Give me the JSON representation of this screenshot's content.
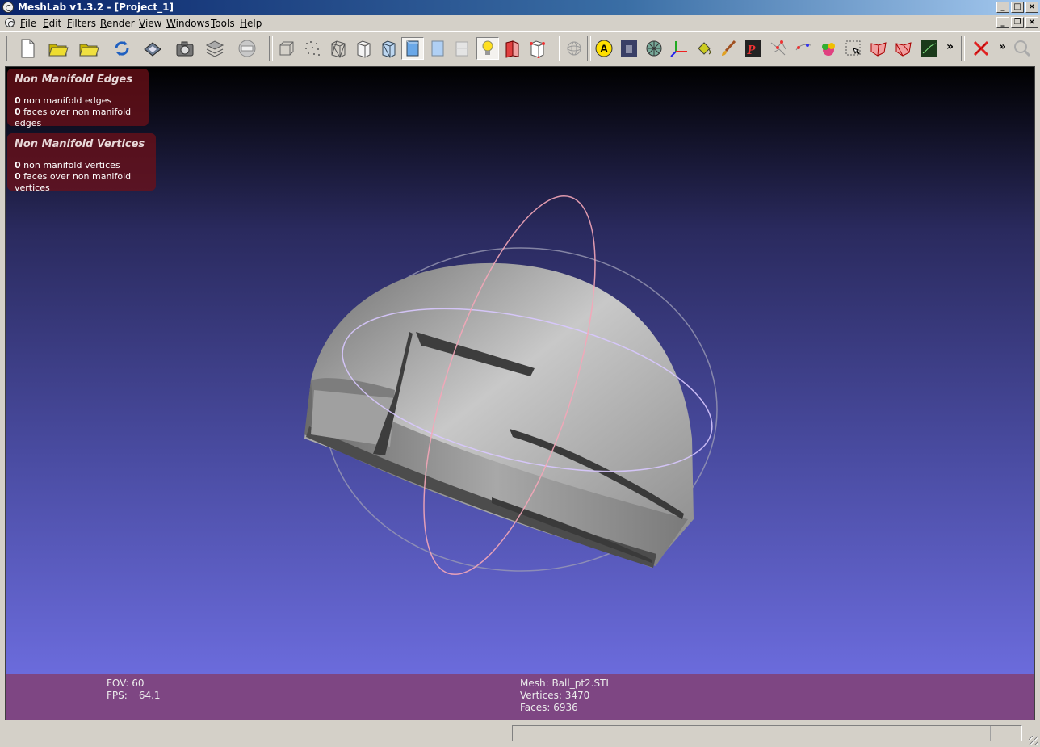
{
  "window": {
    "title": "MeshLab v1.3.2 - [Project_1]"
  },
  "menu": {
    "items": [
      "File",
      "Edit",
      "Filters",
      "Render",
      "View",
      "Windows",
      "Tools",
      "Help"
    ]
  },
  "toolbar": {
    "icons": [
      "new-project-icon",
      "open-project-icon",
      "open-mesh-icon",
      "reload-icon",
      "save-icon",
      "snapshot-icon",
      "layers-icon",
      "fullscreen-icon",
      "bbox-icon",
      "points-icon",
      "wireframe-icon",
      "hidden-lines-icon",
      "flat-lines-icon",
      "flat-icon",
      "smooth-icon",
      "texture-icon",
      "light-icon",
      "backface-icon",
      "color-icon",
      "trackball-icon",
      "info-annotation-icon",
      "shading-icon",
      "manifold-icon",
      "axis-icon",
      "paint-bucket-icon",
      "paint-brush-icon",
      "pickpoints-icon",
      "measure-icon",
      "align-icon",
      "texture-paint-icon",
      "select-icon",
      "select-faces-icon",
      "select-connected-icon",
      "geo-icon",
      "decorate-icon",
      "close-icon",
      "search-icon"
    ],
    "more_glyph": "»"
  },
  "panels": {
    "edges": {
      "title": "Non Manifold Edges",
      "rows": [
        {
          "count": "0",
          "label": "non manifold edges"
        },
        {
          "count": "0",
          "label": "faces over non manifold edges"
        }
      ]
    },
    "vertices": {
      "title": "Non Manifold Vertices",
      "rows": [
        {
          "count": "0",
          "label": "non manifold vertices"
        },
        {
          "count": "0",
          "label": "faces over non manifold vertices"
        }
      ]
    }
  },
  "viewinfo": {
    "fov": "FOV: 60",
    "fps_label": "FPS:",
    "fps_value": "64.1",
    "mesh": "Mesh: Ball_pt2.STL",
    "vertices": "Vertices: 3470",
    "faces": "Faces: 6936"
  },
  "colors": {
    "panel_bg": "#6e1018",
    "info_bar": "#7e4683",
    "viewport_top": "#000000",
    "viewport_bottom": "#7272e8"
  }
}
